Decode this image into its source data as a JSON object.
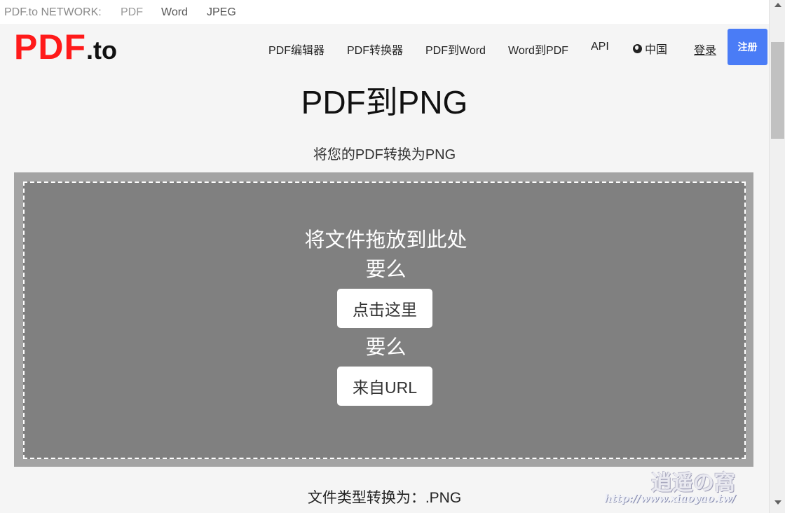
{
  "network_bar": {
    "label": "PDF.to NETWORK:",
    "links": [
      "PDF",
      "Word",
      "JPEG"
    ]
  },
  "header": {
    "logo_main": "PDF",
    "logo_suffix": ".to",
    "logo_color": "#ff1a1a",
    "nav": [
      "PDF编辑器",
      "PDF转换器",
      "PDF到Word",
      "Word到PDF",
      "API"
    ],
    "language": "中国",
    "language_icon": "globe-icon",
    "login": "登录",
    "signup": "注册",
    "signup_color": "#4a7cf6"
  },
  "main": {
    "title": "PDF到PNG",
    "subtitle": "将您的PDF转换为PNG",
    "dropzone": {
      "drop_text": "将文件拖放到此处",
      "or_text_1": "要么",
      "click_button": "点击这里",
      "or_text_2": "要么",
      "url_button": "来自URL"
    },
    "file_type": "文件类型转换为：.PNG"
  },
  "watermark": {
    "text_cn": "逍遥の窩",
    "url": "http://www.xiaoyao.tw/"
  }
}
